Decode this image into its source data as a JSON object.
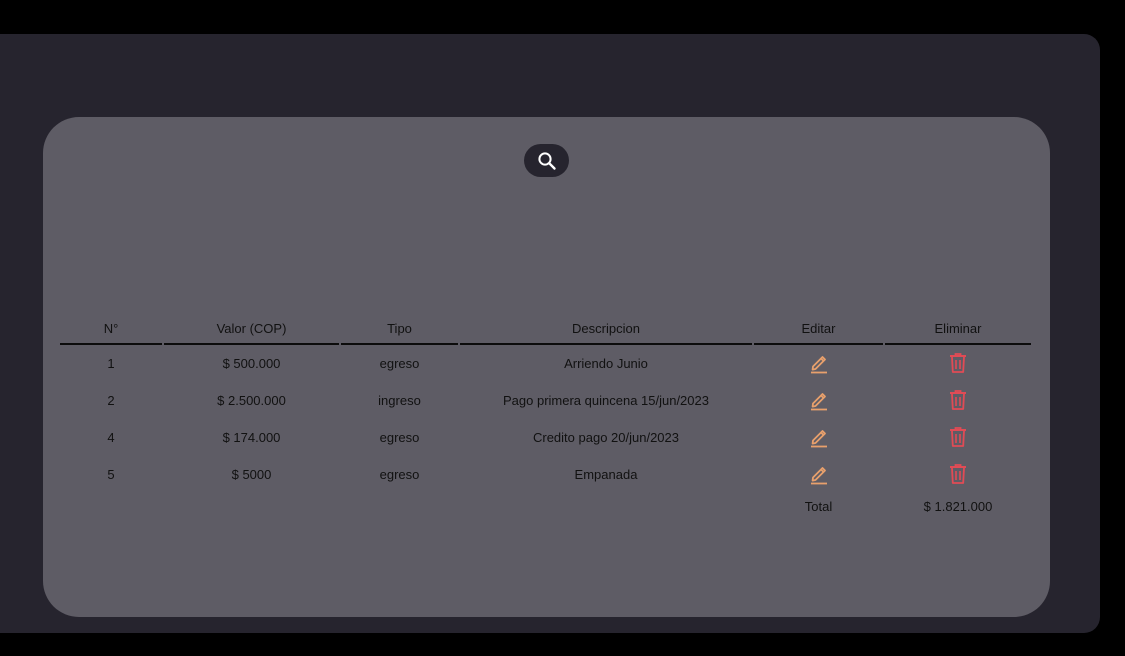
{
  "colors": {
    "page_bg": "#000000",
    "outer_panel": "#26242e",
    "card": "#5e5c65",
    "edit_icon": "#e8a06c",
    "delete_icon": "#e14b55",
    "search_icon": "#ffffff"
  },
  "search": {
    "icon": "search-icon"
  },
  "table": {
    "headers": [
      "N°",
      "Valor (COP)",
      "Tipo",
      "Descripcion",
      "Editar",
      "Eliminar"
    ],
    "rows": [
      {
        "n": "1",
        "valor": "$ 500.000",
        "tipo": "egreso",
        "descripcion": "Arriendo Junio",
        "edit_icon": "pencil-icon",
        "delete_icon": "trash-icon"
      },
      {
        "n": "2",
        "valor": "$ 2.500.000",
        "tipo": "ingreso",
        "descripcion": "Pago primera quincena 15/jun/2023",
        "edit_icon": "pencil-icon",
        "delete_icon": "trash-icon"
      },
      {
        "n": "4",
        "valor": "$ 174.000",
        "tipo": "egreso",
        "descripcion": "Credito pago 20/jun/2023",
        "edit_icon": "pencil-icon",
        "delete_icon": "trash-icon"
      },
      {
        "n": "5",
        "valor": "$ 5000",
        "tipo": "egreso",
        "descripcion": "Empanada",
        "edit_icon": "pencil-icon",
        "delete_icon": "trash-icon"
      }
    ],
    "total_label": "Total",
    "total_value": "$ 1.821.000"
  }
}
